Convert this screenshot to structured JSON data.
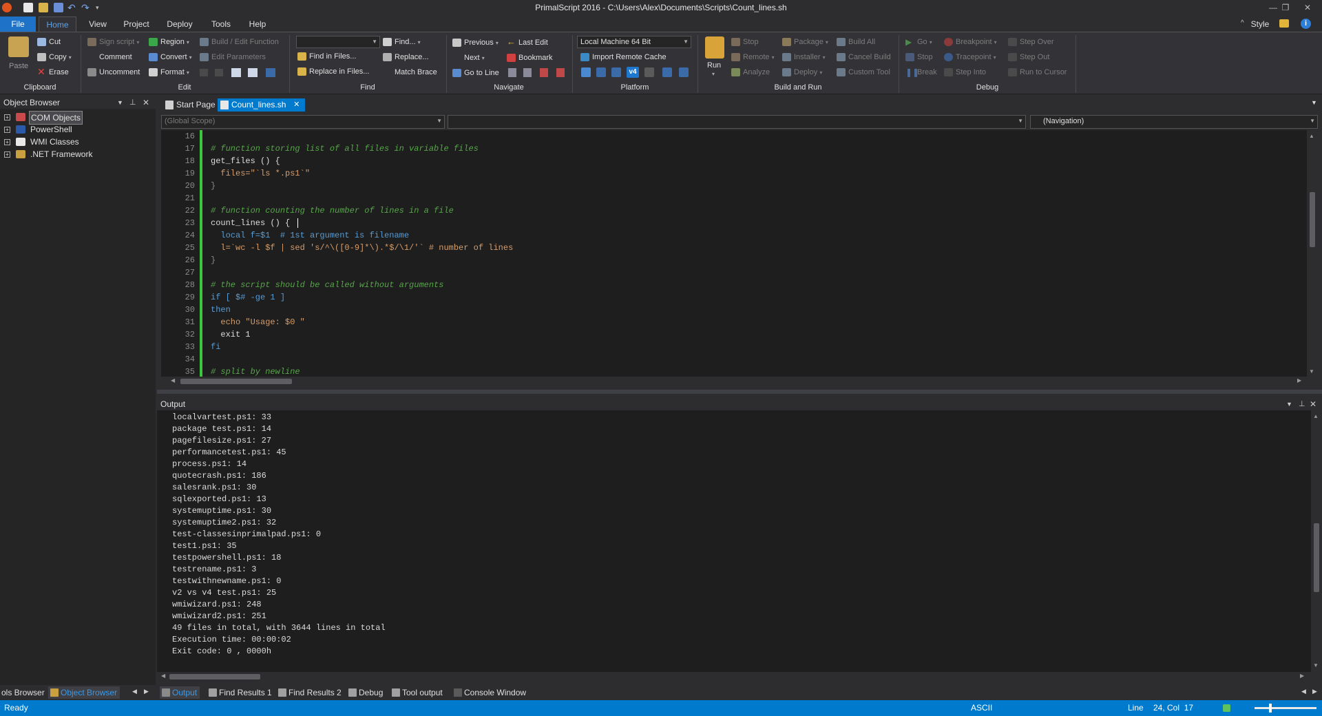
{
  "title": "PrimalScript 2016 - C:\\Users\\Alex\\Documents\\Scripts\\Count_lines.sh",
  "colors": {
    "accent": "#007acc",
    "file_menu": "#1e73c8",
    "change_bar": "#3cc63c",
    "comment": "#57a64a",
    "keyword": "#569cd6",
    "string": "#d69d6b"
  },
  "menu": {
    "file": "File",
    "home": "Home",
    "view": "View",
    "project": "Project",
    "deploy": "Deploy",
    "tools": "Tools",
    "help": "Help",
    "style": "Style"
  },
  "ribbon": {
    "clipboard": {
      "label": "Clipboard",
      "paste": "Paste",
      "cut": "Cut",
      "copy": "Copy",
      "erase": "Erase"
    },
    "edit": {
      "label": "Edit",
      "sign_script": "Sign script",
      "comment": "Comment",
      "uncomment": "Uncomment",
      "region": "Region",
      "convert": "Convert",
      "format": "Format",
      "build_edit_function": "Build / Edit Function",
      "edit_parameters": "Edit Parameters"
    },
    "find": {
      "label": "Find",
      "find": "Find...",
      "find_in_files": "Find in Files...",
      "replace": "Replace...",
      "replace_in_files": "Replace in Files...",
      "match_brace": "Match Brace"
    },
    "navigate": {
      "label": "Navigate",
      "previous": "Previous",
      "next": "Next",
      "go_to_line": "Go to Line",
      "last_edit": "Last Edit",
      "bookmark": "Bookmark"
    },
    "platform": {
      "label": "Platform",
      "machine": "Local Machine 64 Bit",
      "import_remote_cache": "Import Remote Cache",
      "version_badge": "v4"
    },
    "build_and_run": {
      "label": "Build and Run",
      "run": "Run",
      "stop": "Stop",
      "remote": "Remote",
      "analyze": "Analyze",
      "package": "Package",
      "installer": "Installer",
      "deploy": "Deploy",
      "build_all": "Build All",
      "cancel_build": "Cancel Build",
      "custom_tool": "Custom Tool"
    },
    "debug": {
      "label": "Debug",
      "go": "Go",
      "stop": "Stop",
      "break": "Break",
      "breakpoint": "Breakpoint",
      "tracepoint": "Tracepoint",
      "step_into": "Step Into",
      "step_over": "Step Over",
      "step_out": "Step Out",
      "run_to_cursor": "Run to Cursor"
    }
  },
  "object_browser": {
    "title": "Object Browser",
    "items": [
      {
        "label": "COM Objects",
        "icon": "com-objects-icon"
      },
      {
        "label": "PowerShell",
        "icon": "powershell-icon"
      },
      {
        "label": "WMI Classes",
        "icon": "wmi-icon"
      },
      {
        "label": ".NET Framework",
        "icon": "dotnet-icon"
      }
    ]
  },
  "doc_tabs": [
    {
      "label": "Start Page",
      "active": false
    },
    {
      "label": "Count_lines.sh",
      "active": true
    }
  ],
  "scope": {
    "global": "(Global Scope)",
    "member": "",
    "navigation": "(Navigation)"
  },
  "editor": {
    "lines": [
      {
        "n": "16",
        "text": ""
      },
      {
        "n": "17",
        "text": "# function storing list of all files in variable files"
      },
      {
        "n": "18",
        "text": "get_files () {"
      },
      {
        "n": "19",
        "text": "  files=\"`ls *.ps1`\""
      },
      {
        "n": "20",
        "text": "}"
      },
      {
        "n": "21",
        "text": ""
      },
      {
        "n": "22",
        "text": "# function counting the number of lines in a file"
      },
      {
        "n": "23",
        "text": "count_lines () {"
      },
      {
        "n": "24",
        "text": "  local f=$1  # 1st argument is filename"
      },
      {
        "n": "25",
        "text": "  l=`wc -l $f | sed 's/^\\([0-9]*\\).*$/\\1/'` # number of lines"
      },
      {
        "n": "26",
        "text": "}"
      },
      {
        "n": "27",
        "text": ""
      },
      {
        "n": "28",
        "text": "# the script should be called without arguments"
      },
      {
        "n": "29",
        "text": "if [ $# -ge 1 ]"
      },
      {
        "n": "30",
        "text": "then"
      },
      {
        "n": "31",
        "text": "  echo \"Usage: $0 \""
      },
      {
        "n": "32",
        "text": "  exit 1"
      },
      {
        "n": "33",
        "text": "fi"
      },
      {
        "n": "34",
        "text": ""
      },
      {
        "n": "35",
        "text": "# split by newline"
      }
    ]
  },
  "output": {
    "title": "Output",
    "lines": [
      "localvartest.ps1: 33",
      "package test.ps1: 14",
      "pagefilesize.ps1: 27",
      "performancetest.ps1: 45",
      "process.ps1: 14",
      "quotecrash.ps1: 186",
      "salesrank.ps1: 30",
      "sqlexported.ps1: 13",
      "systemuptime.ps1: 30",
      "systemuptime2.ps1: 32",
      "test-classesinprimalpad.ps1: 0",
      "test1.ps1: 35",
      "testpowershell.ps1: 18",
      "testrename.ps1: 3",
      "testwithnewname.ps1: 0",
      "v2 vs v4 test.ps1: 25",
      "wmiwizard.ps1: 248",
      "wmiwizard2.ps1: 251",
      "49 files in total, with 3644 lines in total",
      "Execution time: 00:00:02",
      "Exit code: 0 , 0000h"
    ]
  },
  "bottom_left_tabs": [
    "ols Browser",
    "Object Browser"
  ],
  "bottom_tabs": [
    "Output",
    "Find Results 1",
    "Find Results 2",
    "Debug",
    "Tool output",
    "Console Window"
  ],
  "status": {
    "ready": "Ready",
    "encoding": "ASCII",
    "line_label": "Line",
    "position": "24, Col  17"
  }
}
